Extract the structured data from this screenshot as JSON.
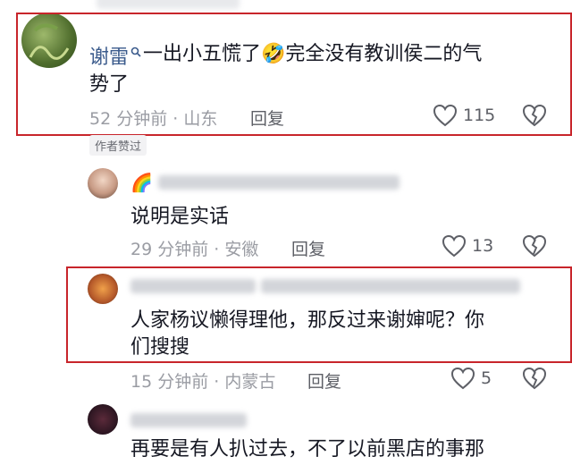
{
  "comments": [
    {
      "username": "谢雷",
      "text": "一出小五慌了🤣完全没有教训侯二的气势了",
      "text_line1": "一出小五慌了",
      "text_line1_after": "完全没有教训侯二的气",
      "text_line2": "势了",
      "time": "52 分钟前 · 山东",
      "reply_label": "回复",
      "likes": "115",
      "badge": "作者赞过",
      "emoji": "🤣"
    },
    {
      "username": "🌈",
      "text": "说明是实话",
      "time": "29 分钟前 · 安徽",
      "reply_label": "回复",
      "likes": "13"
    },
    {
      "text_line1": "人家杨议懒得理他，那反过来谢婶呢？你",
      "text_line2": "们搜搜",
      "time": "15 分钟前 · 内蒙古",
      "reply_label": "回复",
      "likes": "5"
    },
    {
      "text_line1": "再要是有人扒过去，不了以前黑店的事那"
    }
  ],
  "colors": {
    "highlight_border": "#c8252b",
    "text": "#161823",
    "meta": "#9a9ca3",
    "username_blue": "#3b5b8c"
  }
}
